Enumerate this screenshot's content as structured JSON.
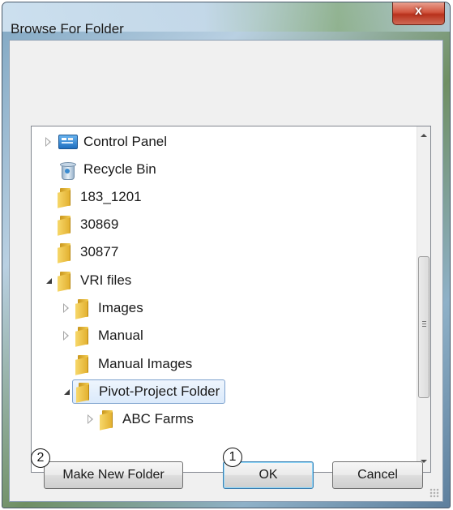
{
  "window": {
    "title": "Browse For Folder",
    "close_label": "x"
  },
  "tree": {
    "items": [
      {
        "label": "Control Panel",
        "icon": "control-panel-icon",
        "expander": "collapsed"
      },
      {
        "label": "Recycle Bin",
        "icon": "recycle-bin-icon",
        "expander": "none"
      },
      {
        "label": "183_1201",
        "icon": "folder-icon",
        "expander": "none"
      },
      {
        "label": "30869",
        "icon": "folder-icon",
        "expander": "none"
      },
      {
        "label": "30877",
        "icon": "folder-icon",
        "expander": "none"
      },
      {
        "label": "VRI files",
        "icon": "folder-icon",
        "expander": "expanded"
      },
      {
        "label": "Images",
        "icon": "folder-icon",
        "expander": "collapsed"
      },
      {
        "label": "Manual",
        "icon": "folder-icon",
        "expander": "collapsed"
      },
      {
        "label": "Manual Images",
        "icon": "folder-icon",
        "expander": "none"
      },
      {
        "label": "Pivot-Project Folder",
        "icon": "folder-icon",
        "expander": "expanded",
        "selected": true
      },
      {
        "label": "ABC Farms",
        "icon": "folder-icon",
        "expander": "collapsed"
      }
    ]
  },
  "buttons": {
    "make_new_folder": "Make New Folder",
    "ok": "OK",
    "cancel": "Cancel"
  },
  "callouts": {
    "one": "1",
    "two": "2"
  },
  "colors": {
    "selection_border": "#7da2ce",
    "selection_fill": "#dbeafb",
    "close_button": "#c8432d"
  }
}
